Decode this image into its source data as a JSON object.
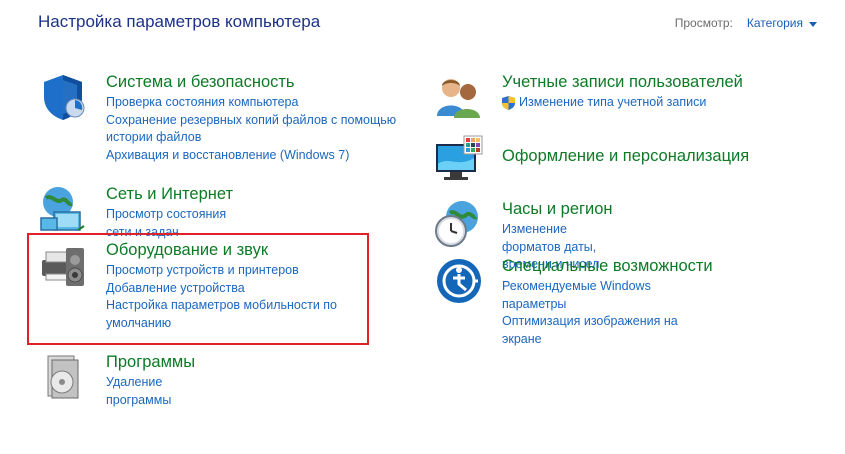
{
  "header": {
    "title": "Настройка параметров компьютера",
    "view_label": "Просмотр:",
    "view_value": "Категория"
  },
  "left_column": [
    {
      "icon": "shield-security-icon",
      "title": "Система и безопасность",
      "links": [
        "Проверка состояния компьютера",
        "Сохранение резервных копий файлов с помощью истории файлов",
        "Архивация и восстановление (Windows 7)"
      ]
    },
    {
      "icon": "network-globe-icon",
      "title": "Сеть и Интернет",
      "links": [
        "Просмотр состояния сети и задач"
      ]
    },
    {
      "icon": "printer-speaker-icon",
      "title": "Оборудование и звук",
      "links": [
        "Просмотр устройств и принтеров",
        "Добавление устройства",
        "Настройка параметров мобильности по умолчанию"
      ]
    },
    {
      "icon": "programs-disc-icon",
      "title": "Программы",
      "links": [
        "Удаление программы"
      ]
    }
  ],
  "right_column": [
    {
      "icon": "users-icon",
      "title": "Учетные записи пользователей",
      "links": [
        "Изменение типа учетной записи"
      ]
    },
    {
      "icon": "monitor-personalization-icon",
      "title": "Оформление и персонализация",
      "links": []
    },
    {
      "icon": "clock-globe-icon",
      "title": "Часы и регион",
      "links": [
        "Изменение форматов даты, времени и чисел"
      ]
    },
    {
      "icon": "accessibility-icon",
      "title": "Специальные возможности",
      "links": [
        "Рекомендуемые Windows параметры",
        "Оптимизация изображения на экране"
      ]
    }
  ],
  "colors": {
    "title": "#1e3287",
    "category": "#0d7a26",
    "link": "#1b67c0",
    "highlight": "#e0212a"
  }
}
